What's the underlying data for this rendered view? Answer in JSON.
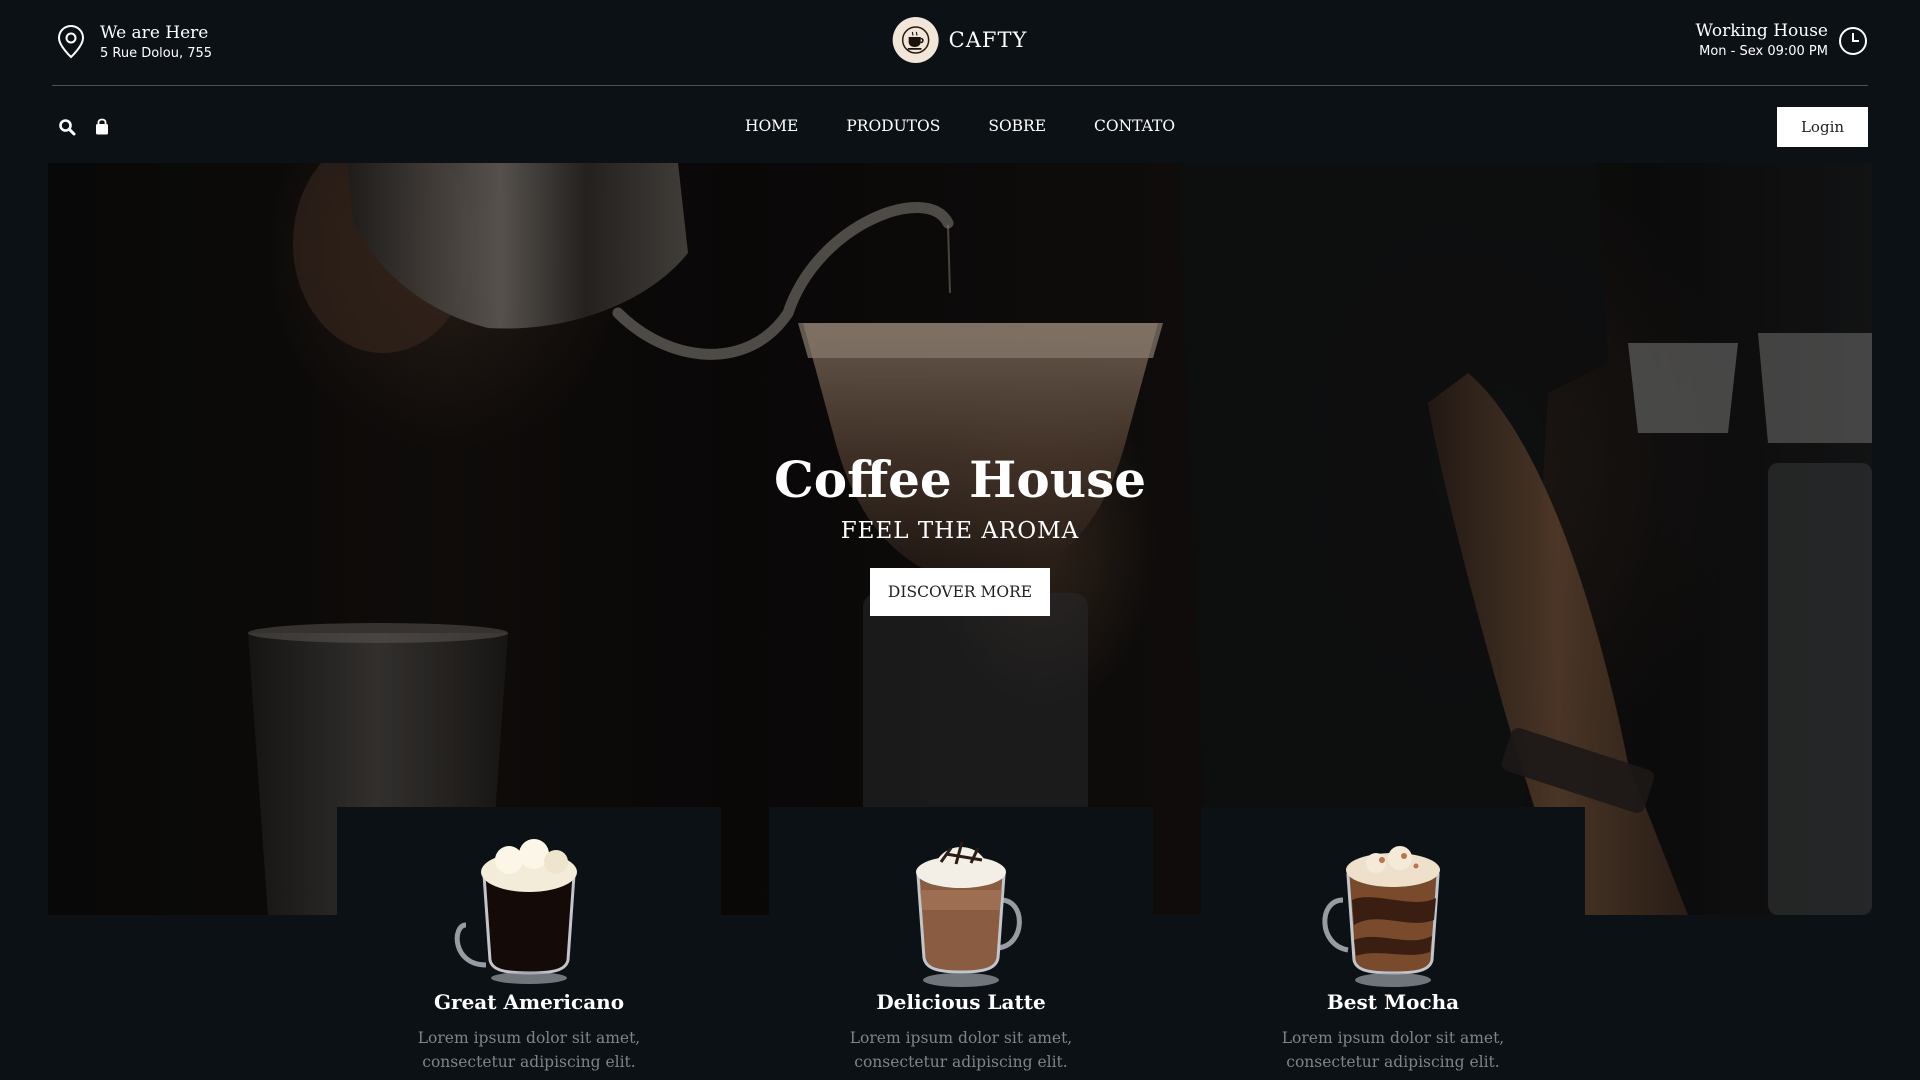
{
  "location": {
    "title": "We are Here",
    "address": "5 Rue Dolou, 755",
    "icon": "map-pin-icon"
  },
  "brand": {
    "name": "CAFTY",
    "icon": "coffee-cup-icon"
  },
  "hours": {
    "title": "Working House",
    "schedule": "Mon - Sex 09:00 PM",
    "icon": "clock-icon"
  },
  "nav": {
    "icons": [
      "search-icon",
      "shopping-bag-icon"
    ],
    "items": [
      "HOME",
      "PRODUTOS",
      "SOBRE",
      "CONTATO"
    ],
    "login_label": "Login"
  },
  "hero": {
    "title": "Coffee House",
    "subtitle": "FEEL THE AROMA",
    "button_label": "DISCOVER MORE"
  },
  "products": [
    {
      "name": "Great Americano",
      "description": "Lorem ipsum dolor sit amet, consectetur adipiscing elit."
    },
    {
      "name": "Delicious Latte",
      "description": "Lorem ipsum dolor sit amet, consectetur adipiscing elit."
    },
    {
      "name": "Best Mocha",
      "description": "Lorem ipsum dolor sit amet, consectetur adipiscing elit."
    }
  ],
  "colors": {
    "background": "#0c1116",
    "text": "#ffffff",
    "muted_text": "#7e848a",
    "button_bg": "#ffffff"
  }
}
